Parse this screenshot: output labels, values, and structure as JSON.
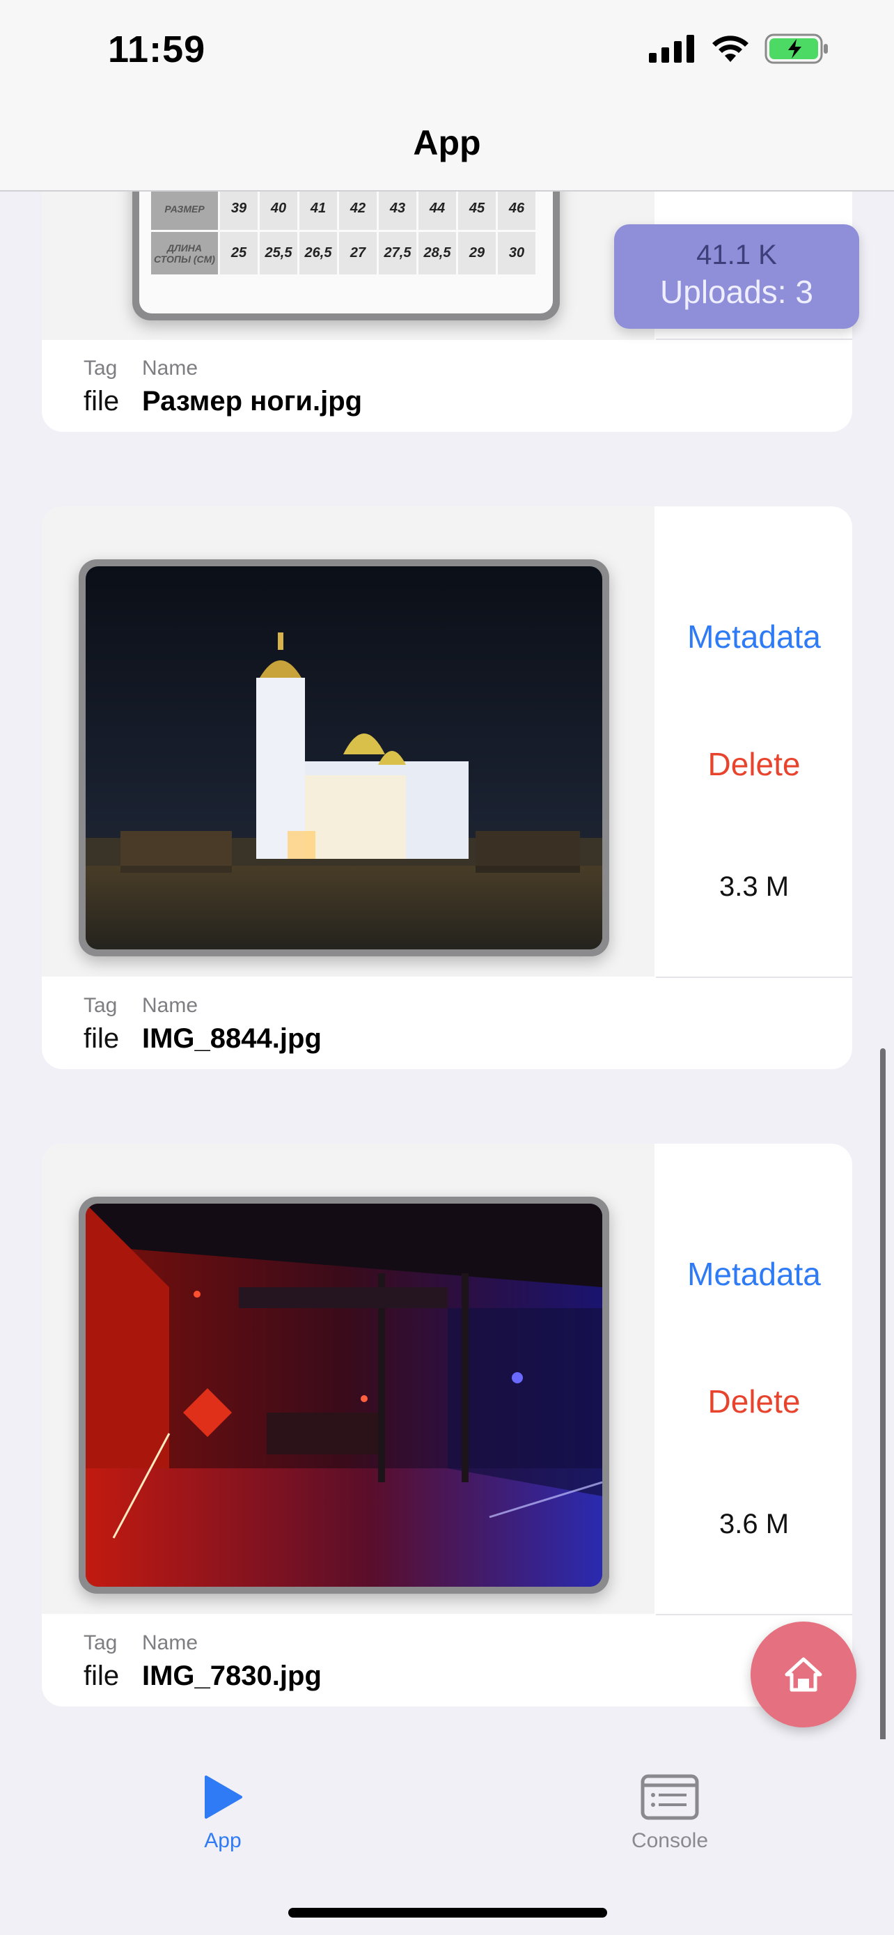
{
  "status_bar": {
    "time": "11:59"
  },
  "nav": {
    "title": "App"
  },
  "upload_indicator": {
    "size": "41.1 K",
    "uploads": "Uploads: 3"
  },
  "size_chart": {
    "header_row_label": "РАЗМЕР",
    "length_row_label": "ДЛИНА СТОПЫ (СМ)",
    "sizes": [
      "39",
      "40",
      "41",
      "42",
      "43",
      "44",
      "45",
      "46"
    ],
    "lengths": [
      "25",
      "25,5",
      "26,5",
      "27",
      "27,5",
      "28,5",
      "29",
      "30"
    ]
  },
  "files": [
    {
      "tag_header": "Tag",
      "name_header": "Name",
      "tag": "file",
      "name": "Размер ноги.jpg"
    },
    {
      "tag_header": "Tag",
      "name_header": "Name",
      "tag": "file",
      "name": "IMG_8844.jpg",
      "metadata_label": "Metadata",
      "delete_label": "Delete",
      "size": "3.3 M"
    },
    {
      "tag_header": "Tag",
      "name_header": "Name",
      "tag": "file",
      "name": "IMG_7830.jpg",
      "metadata_label": "Metadata",
      "delete_label": "Delete",
      "size": "3.6 M"
    }
  ],
  "tabs": [
    {
      "label": "App",
      "icon": "play-icon",
      "active": true
    },
    {
      "label": "Console",
      "icon": "console-icon",
      "active": false
    }
  ],
  "colors": {
    "accent": "#2f7bf5",
    "destructive": "#e8432d",
    "fab": "#e5707f",
    "upload_pill": "#8f8fd9"
  }
}
